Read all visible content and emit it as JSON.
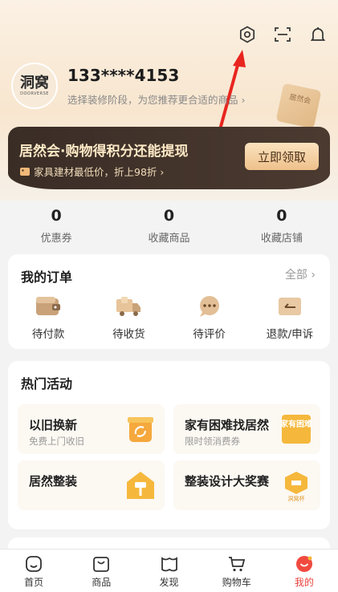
{
  "user": {
    "phone": "133****4153",
    "subtitle": "选择装修阶段，为您推荐更合适的商品 ›",
    "avatar_logo": "洞窝",
    "avatar_logo_en": "DOORVERSE",
    "badge_text": "居然会"
  },
  "top_icons": [
    "settings-icon",
    "scan-icon",
    "bell-icon"
  ],
  "promo": {
    "title": "居然会·购物得积分还能提现",
    "subtitle": "家具建材最低价，折上98折 ›",
    "button": "立即领取"
  },
  "stats": [
    {
      "value": "0",
      "label": "优惠券"
    },
    {
      "value": "0",
      "label": "收藏商品"
    },
    {
      "value": "0",
      "label": "收藏店铺"
    }
  ],
  "orders": {
    "title": "我的订单",
    "more": "全部 ›",
    "items": [
      {
        "label": "待付款",
        "icon": "wallet-icon"
      },
      {
        "label": "待收货",
        "icon": "truck-icon"
      },
      {
        "label": "待评价",
        "icon": "comment-icon"
      },
      {
        "label": "退款/申诉",
        "icon": "refund-icon"
      }
    ]
  },
  "activities": {
    "title": "热门活动",
    "items": [
      {
        "title": "以旧换新",
        "sub": "免费上门收旧",
        "icon": "recycle-box-icon"
      },
      {
        "title": "家有困难找居然",
        "sub": "限时领消费券",
        "icon": "help-badge-icon",
        "icon_text": "家有困难"
      },
      {
        "title": "居然整装",
        "sub": "",
        "icon": "paint-roller-house-icon"
      },
      {
        "title": "整装设计大奖赛",
        "sub": "",
        "icon": "design-award-icon",
        "icon_text": "洞窝杯"
      }
    ]
  },
  "tabs": [
    {
      "label": "首页",
      "icon": "home-icon"
    },
    {
      "label": "商品",
      "icon": "shopping-bag-icon"
    },
    {
      "label": "发现",
      "icon": "discover-icon"
    },
    {
      "label": "购物车",
      "icon": "cart-icon"
    },
    {
      "label": "我的",
      "icon": "profile-icon",
      "active": true
    }
  ],
  "colors": {
    "accent": "#e8423b",
    "promo_bg": "#3a2d26",
    "gold": "#f5b83c"
  }
}
